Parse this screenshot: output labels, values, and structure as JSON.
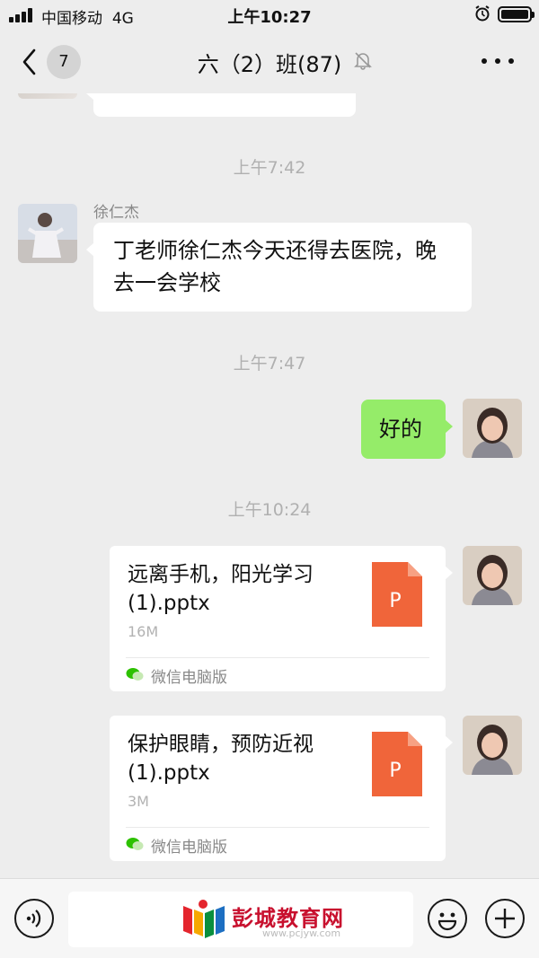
{
  "status_bar": {
    "carrier": "中国移动",
    "network": "4G",
    "time": "上午10:27"
  },
  "nav": {
    "unread_count": "7",
    "title": "六（2）班(87)"
  },
  "chat": {
    "timestamps": [
      "上午7:42",
      "上午7:47",
      "上午10:24"
    ],
    "messages": [
      {
        "sender": "徐仁杰",
        "text": "丁老师徐仁杰今天还得去医院，晚去一会学校"
      },
      {
        "text": "好的"
      }
    ],
    "files": [
      {
        "name": "远离手机，阳光学习(1).pptx",
        "size": "16M",
        "source": "微信电脑版",
        "icon_letter": "P"
      },
      {
        "name": "保护眼睛，预防近视(1).pptx",
        "size": "3M",
        "source": "微信电脑版",
        "icon_letter": "P"
      }
    ]
  },
  "watermark": {
    "text": "彭城教育网",
    "sub": "www.pcjyw.com"
  },
  "colors": {
    "background": "#ededed",
    "bubble_self": "#95ec69",
    "bubble_other": "#ffffff",
    "file_icon": "#f0653a"
  }
}
